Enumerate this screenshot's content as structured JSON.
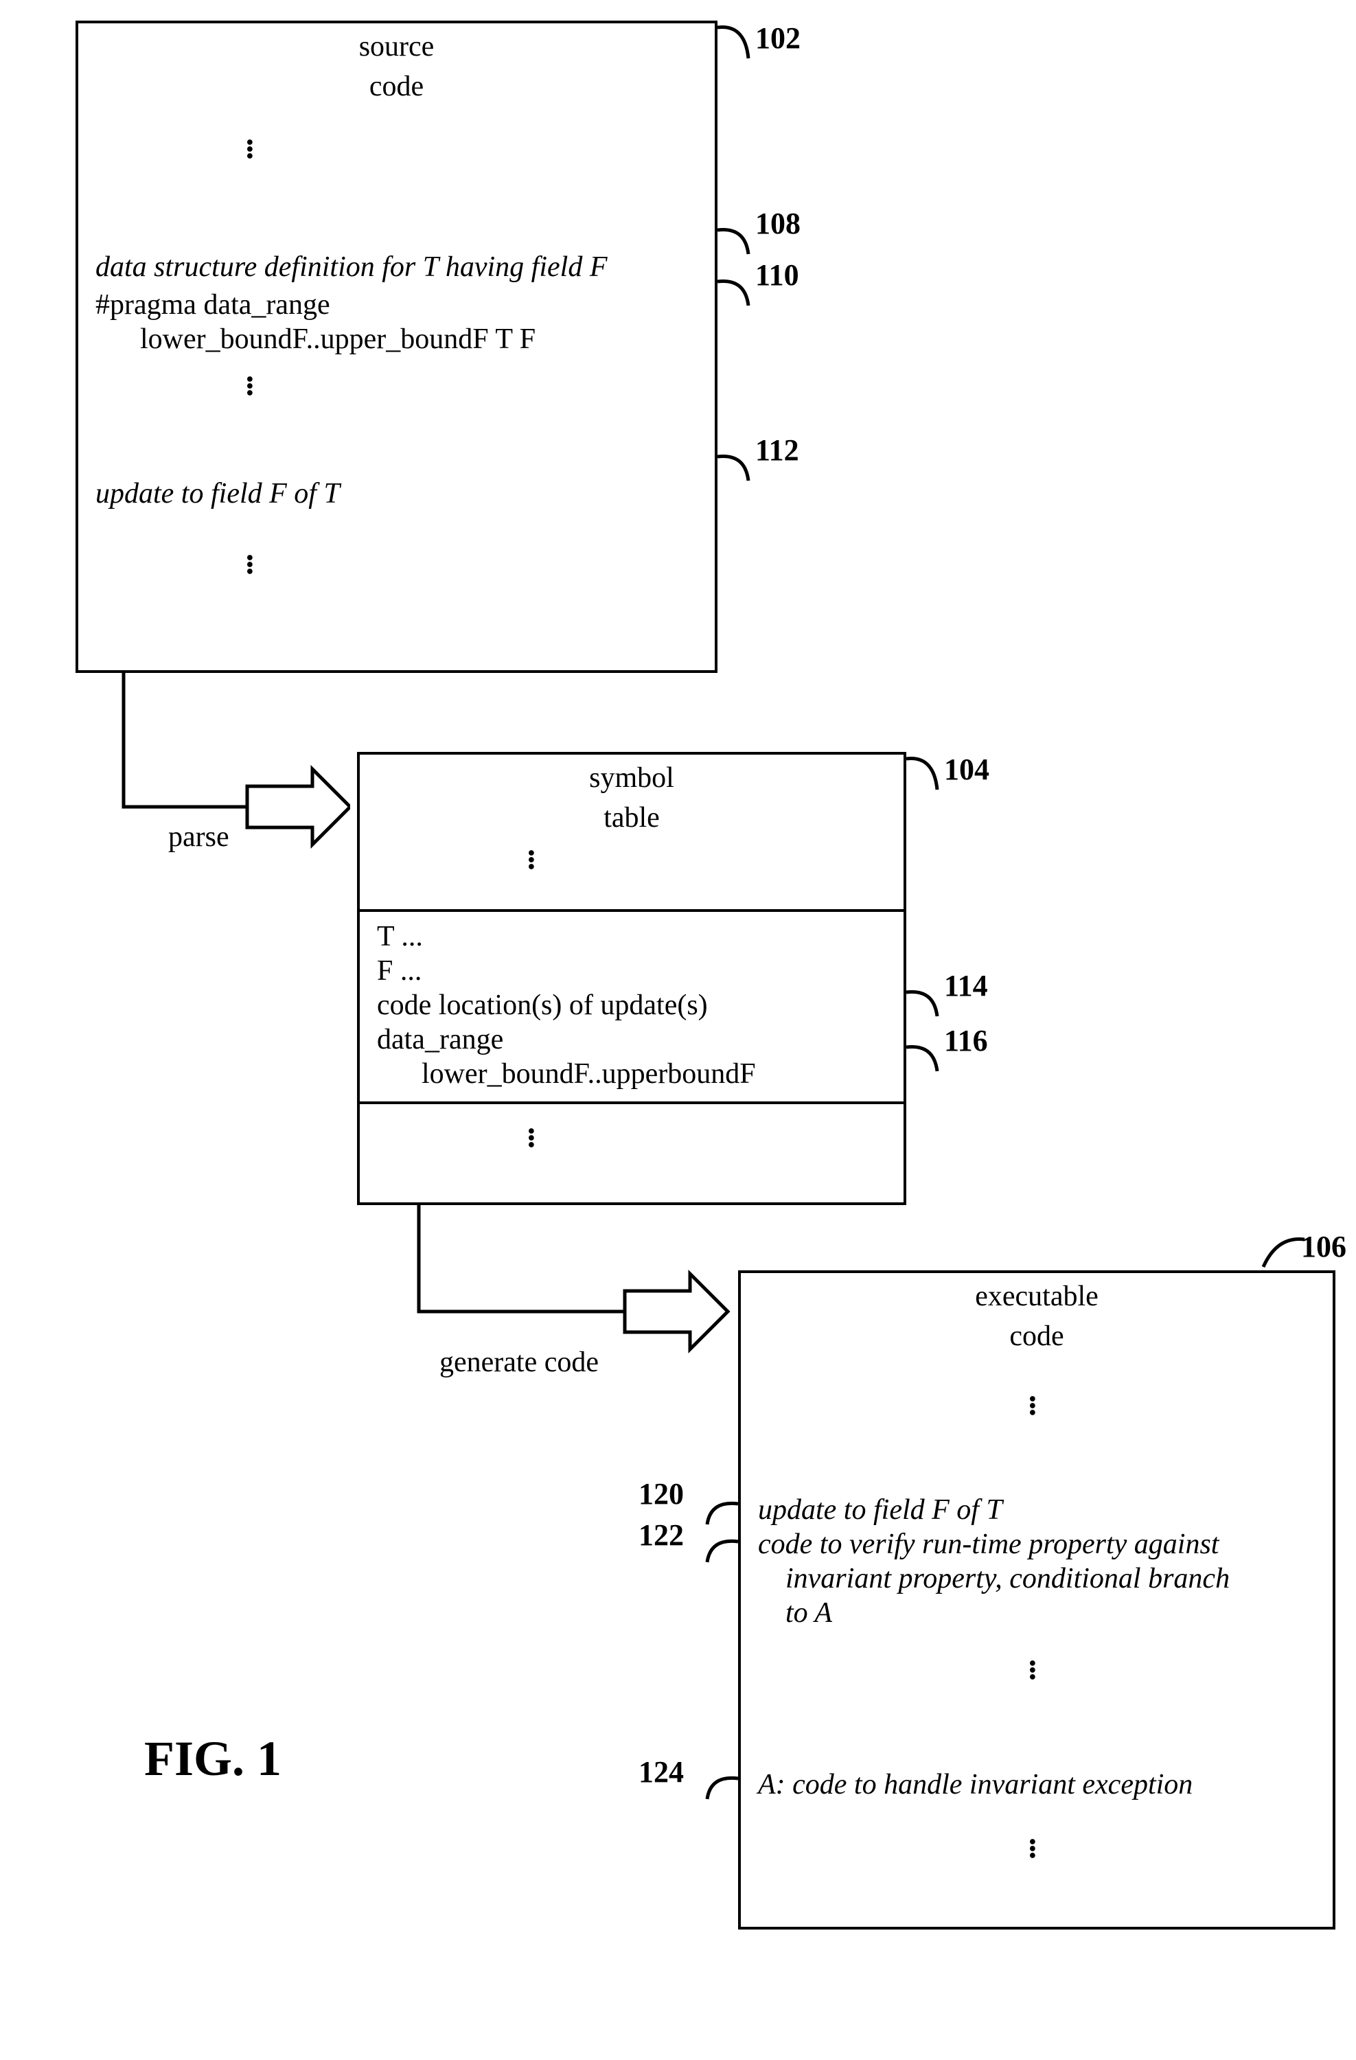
{
  "figure_label": "FIG. 1",
  "refs": {
    "r102": "102",
    "r104": "104",
    "r106": "106",
    "r108": "108",
    "r110": "110",
    "r112": "112",
    "r114": "114",
    "r116": "116",
    "r120": "120",
    "r122": "122",
    "r124": "124"
  },
  "arrows": {
    "parse": "parse",
    "generate": "generate code"
  },
  "source_box": {
    "title1": "source",
    "title2": "code",
    "line108": "data structure definition for T having field F",
    "line110a": "#pragma data_range",
    "line110b": "lower_boundF..upper_boundF T F",
    "line112": "update to field F of T"
  },
  "symbol_box": {
    "title1": "symbol",
    "title2": "table",
    "t_line": "T ...",
    "f_line": "F ...",
    "loc_line": "code location(s) of update(s)",
    "dr_line": "data_range",
    "dr_indent": "lower_boundF..upperboundF"
  },
  "exec_box": {
    "title1": "executable",
    "title2": "code",
    "line120": "update to field F of T",
    "line122a": "code to verify run-time property against",
    "line122b": "invariant property, conditional branch",
    "line122c": "to A",
    "line124": "A: code to handle invariant exception"
  }
}
